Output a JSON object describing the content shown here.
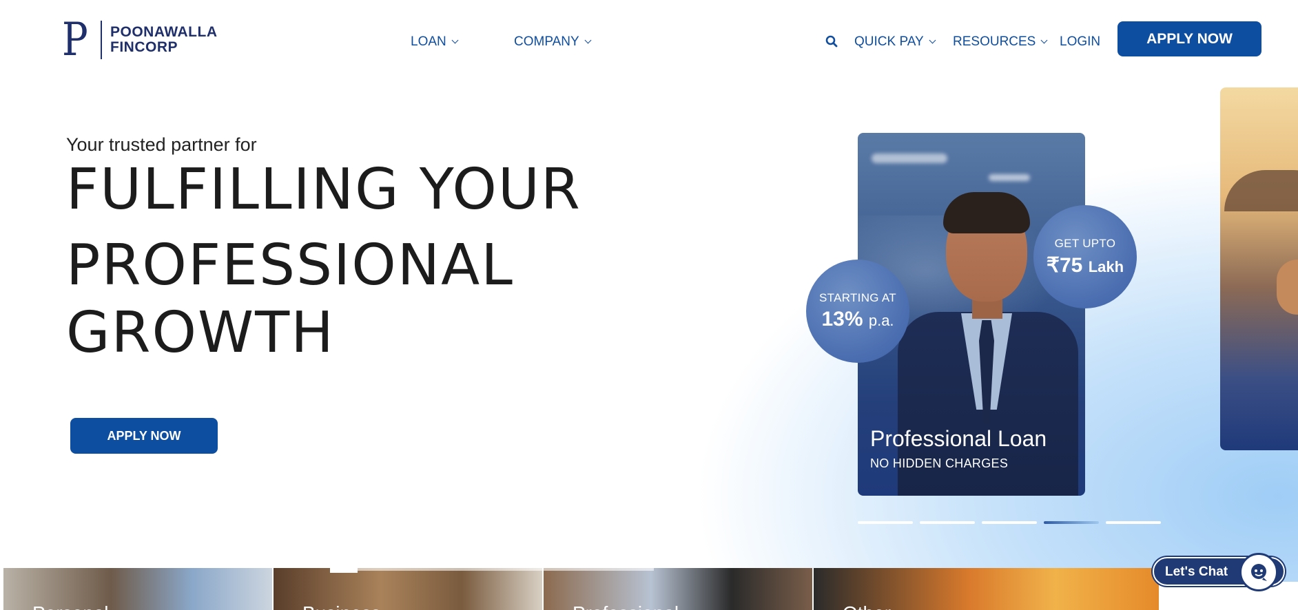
{
  "brand": {
    "mark": "P",
    "name_line1": "POONAWALLA",
    "name_line2": "FINCORP",
    "color": "#1f2f6b"
  },
  "nav": {
    "loan": "LOAN",
    "company": "COMPANY",
    "quick_pay": "QUICK PAY",
    "resources": "RESOURCES",
    "login": "LOGIN",
    "apply_now": "APPLY NOW"
  },
  "hero": {
    "subtitle": "Your trusted partner for",
    "title_line1": "FULFILLING YOUR",
    "title_line2": "PROFESSIONAL",
    "title_line3": "GROWTH",
    "apply_button": "APPLY NOW"
  },
  "card": {
    "title": "Professional Loan",
    "note": "NO HIDDEN CHARGES",
    "badge_rate_top": "STARTING AT",
    "badge_rate_value": "13%",
    "badge_rate_unit": "p.a.",
    "badge_amount_top": "GET UPTO",
    "badge_amount_value": "₹75",
    "badge_amount_unit": "Lakh"
  },
  "carousel": {
    "slides": 5,
    "active_index": 3
  },
  "bottom_tiles": [
    {
      "label": "Personal"
    },
    {
      "label": "Business"
    },
    {
      "label": "Professional"
    },
    {
      "label": "Other"
    }
  ],
  "chat": {
    "label": "Let's Chat"
  },
  "colors": {
    "primary": "#0d4ea1",
    "nav_text": "#0f4d9e",
    "chat_bg": "#1f3a74"
  },
  "icons": {
    "search": "search-icon",
    "chevron": "chevron-down-icon",
    "chat": "chatbot-icon"
  }
}
